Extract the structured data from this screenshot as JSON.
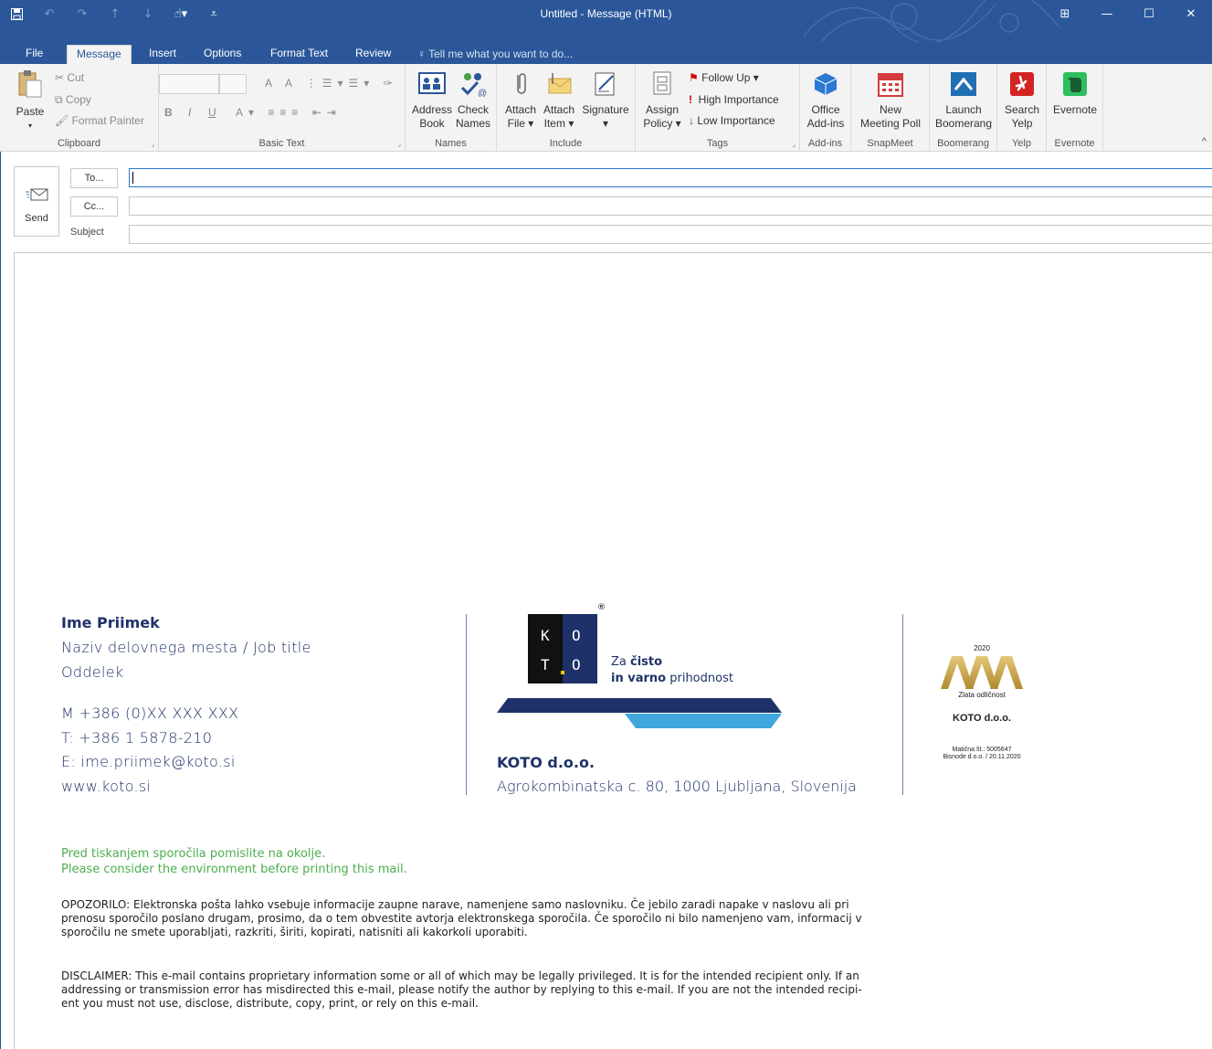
{
  "window": {
    "title": "Untitled - Message (HTML)",
    "controls": [
      "restore-ribbon",
      "minimize",
      "maximize",
      "close"
    ]
  },
  "quick_access": [
    "save",
    "undo",
    "redo",
    "previous",
    "next",
    "touch-mode",
    "customize"
  ],
  "tabs": {
    "file": "File",
    "message": "Message",
    "insert": "Insert",
    "options": "Options",
    "format_text": "Format Text",
    "review": "Review",
    "tell_me": "Tell me what you want to do..."
  },
  "ribbon": {
    "clipboard": {
      "label": "Clipboard",
      "paste": "Paste",
      "cut": "Cut",
      "copy": "Copy",
      "format_painter": "Format Painter"
    },
    "basic_text": {
      "label": "Basic Text",
      "bold": "B",
      "italic": "I",
      "underline": "U"
    },
    "names": {
      "label": "Names",
      "address_book_1": "Address",
      "address_book_2": "Book",
      "check_names_1": "Check",
      "check_names_2": "Names"
    },
    "include": {
      "label": "Include",
      "attach_file_1": "Attach",
      "attach_file_2": "File ▾",
      "attach_item_1": "Attach",
      "attach_item_2": "Item ▾",
      "signature_1": "Signature",
      "signature_2": "▾"
    },
    "tags": {
      "label": "Tags",
      "assign_policy_1": "Assign",
      "assign_policy_2": "Policy ▾",
      "follow_up": "Follow Up ▾",
      "high_importance": "High Importance",
      "low_importance": "Low Importance"
    },
    "add_ins": {
      "label": "Add-ins",
      "office_1": "Office",
      "office_2": "Add-ins"
    },
    "snapmeet": {
      "label": "SnapMeet",
      "new_1": "New",
      "new_2": "Meeting Poll"
    },
    "boomerang": {
      "label": "Boomerang",
      "launch_1": "Launch",
      "launch_2": "Boomerang"
    },
    "yelp": {
      "label": "Yelp",
      "search_1": "Search",
      "search_2": "Yelp"
    },
    "evernote": {
      "label": "Evernote",
      "evernote": "Evernote"
    }
  },
  "compose": {
    "send": "Send",
    "to": "To...",
    "cc": "Cc...",
    "subject": "Subject",
    "to_value": "",
    "cc_value": "",
    "subject_value": ""
  },
  "signature": {
    "name": "Ime Priimek",
    "job_title": "Naziv delovnega mesta / Job title",
    "department": "Oddelek",
    "mobile": "M +386 (0)XX XXX XXX",
    "phone": "T: +386 1 5878-210",
    "email": "E: ime.priimek@koto.si",
    "web": "www.koto.si",
    "logo_letters": [
      "K",
      "O",
      "T",
      "O"
    ],
    "reg_mark": "®",
    "tag_za": "Za",
    "tag_cisto": "čisto",
    "tag_in_varno": "in varno",
    "tag_prihodnost": "prihodnost",
    "company": "KOTO d.o.o.",
    "address": "Agrokombinatska c. 80, 1000 Ljubljana, Slovenija",
    "aaa_year": "2020",
    "aaa_rating": "Zlata odličnost",
    "aaa_company": "KOTO d.o.o.",
    "aaa_maticna": "Matična št.: 5005647",
    "aaa_bisnode": "Bisnode d.o.o. / 20.11.2020"
  },
  "footer": {
    "env_sl": "Pred tiskanjem sporočila pomislite na okolje.",
    "env_en": "Please consider the environment before printing this mail.",
    "warning_1": "OPOZORILO: Elektronska pošta lahko vsebuje informacije zaupne narave, namenjene samo naslovniku.  Če jebilo zaradi napake v naslovu ali pri",
    "warning_2": "prenosu sporočilo poslano drugam, prosimo, da o tem obvestite avtorja elektronskega sporočila.  Če sporočilo ni bilo namenjeno vam, informacij v",
    "warning_3": "sporočilu ne smete uporabljati, razkriti, širiti, kopirati, natisniti ali kakorkoli uporabiti.",
    "disclaimer_1": "DISCLAIMER: This e-mail contains proprietary information some or all of which may be legally privileged.  It is for the intended recipient only. If an",
    "disclaimer_2": "addressing or transmission error has misdirected this e-mail, please notify the author by replying to this e-mail. If you are not the intended recipi-",
    "disclaimer_3": "ent you must not use, disclose, distribute, copy, print, or rely on this e-mail."
  },
  "colors": {
    "title_bar": "#2b579a",
    "ribbon": "#f3f3f3",
    "brand_navy": "#1e3269",
    "brand_light_blue": "#3fa7dc",
    "green_note": "#4caf50",
    "aaa_gold": "#c9a44a"
  }
}
